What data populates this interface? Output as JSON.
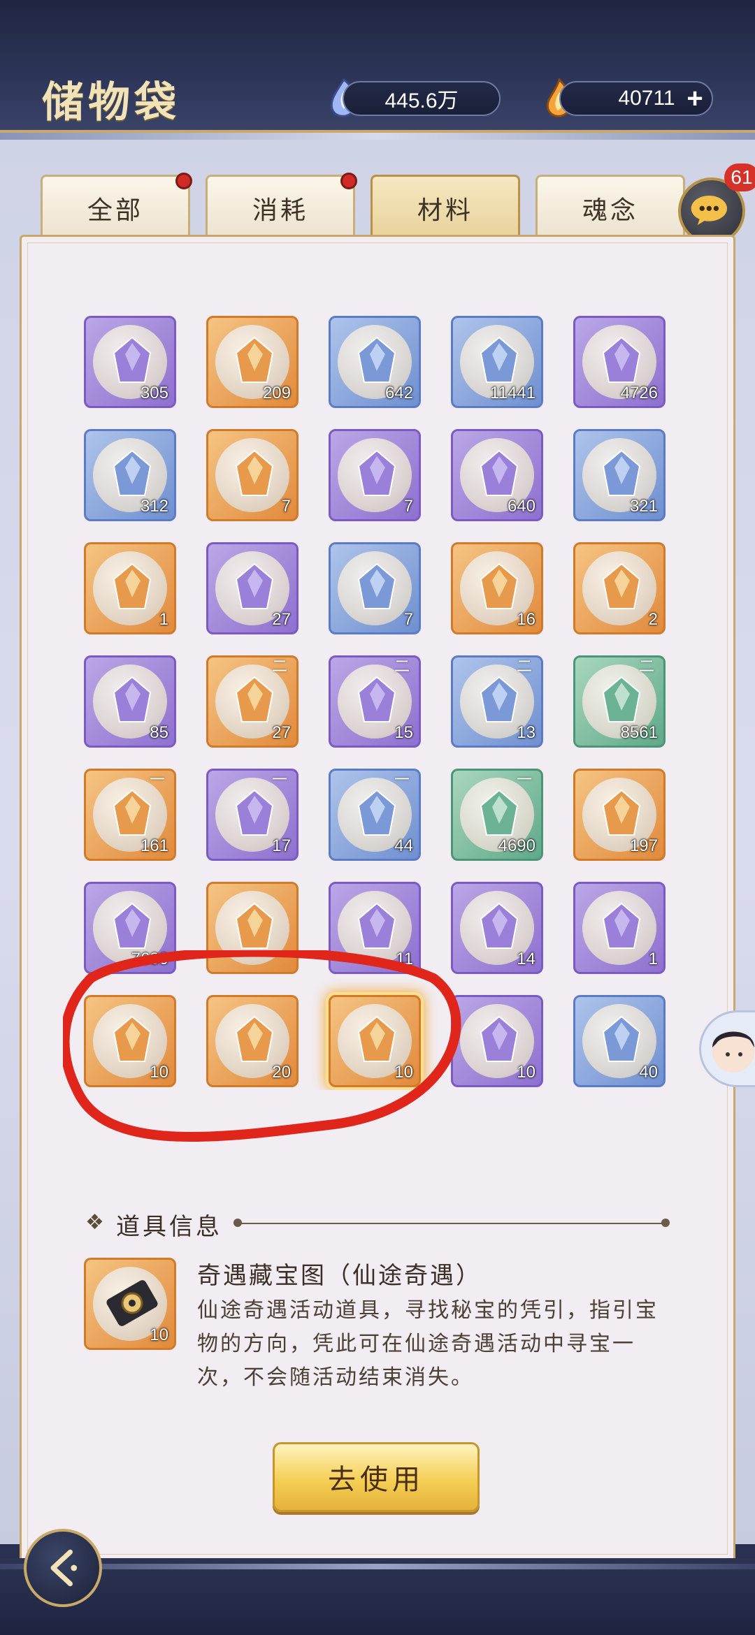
{
  "header": {
    "title": "储物袋",
    "currency_spirit": "445.6万",
    "currency_gold": "40711",
    "add_label": "+"
  },
  "tabs": [
    {
      "label": "全部",
      "has_dot": true
    },
    {
      "label": "消耗",
      "has_dot": true
    },
    {
      "label": "材料",
      "active": true
    },
    {
      "label": "魂念"
    }
  ],
  "chat": {
    "badge": "61",
    "icon": "chat-bubble-icon"
  },
  "grid": {
    "rows": [
      [
        {
          "count": "305",
          "rarity": "purple",
          "icon": "pink-gem-on-stand-icon"
        },
        {
          "count": "209",
          "rarity": "orange",
          "icon": "fire-beast-icon"
        },
        {
          "count": "642",
          "rarity": "blue",
          "icon": "blue-orb-icon"
        },
        {
          "count": "11441",
          "rarity": "blue",
          "icon": "cyan-crystal-shard-icon"
        },
        {
          "count": "4726",
          "rarity": "purple",
          "icon": "purple-crystal-cluster-icon"
        }
      ],
      [
        {
          "count": "312",
          "rarity": "blue",
          "icon": "blue-crystal-cluster-icon"
        },
        {
          "count": "7",
          "rarity": "orange",
          "icon": "red-pendant-icon"
        },
        {
          "count": "7",
          "rarity": "purple",
          "icon": "purple-crystal-icon"
        },
        {
          "count": "640",
          "rarity": "purple",
          "icon": "violet-crystal-icon"
        },
        {
          "count": "321",
          "rarity": "blue",
          "icon": "blue-egg-icon"
        }
      ],
      [
        {
          "count": "1",
          "rarity": "orange",
          "icon": "dark-sun-orb-icon"
        },
        {
          "count": "27",
          "rarity": "purple",
          "icon": "swirl-cloud-icon"
        },
        {
          "count": "7",
          "rarity": "blue",
          "icon": "gold-crystal-icon"
        },
        {
          "count": "16",
          "rarity": "orange",
          "icon": "scroll-bundle-icon"
        },
        {
          "count": "2",
          "rarity": "orange",
          "icon": "purple-scroll-icon"
        }
      ],
      [
        {
          "count": "85",
          "rarity": "purple",
          "icon": "green-herb-icon"
        },
        {
          "count": "27",
          "rarity": "orange",
          "icon": "blue-lotus-icon",
          "tier": "二"
        },
        {
          "count": "15",
          "rarity": "purple",
          "icon": "red-berries-icon",
          "tier": "二"
        },
        {
          "count": "13",
          "rarity": "blue",
          "icon": "stone-blocks-icon",
          "tier": "二"
        },
        {
          "count": "8561",
          "rarity": "green",
          "icon": "jade-ring-icon",
          "tier": "二"
        }
      ],
      [
        {
          "count": "161",
          "rarity": "orange",
          "icon": "purple-grass-icon",
          "tier": "一"
        },
        {
          "count": "17",
          "rarity": "purple",
          "icon": "orange-berries-icon",
          "tier": "一"
        },
        {
          "count": "44",
          "rarity": "blue",
          "icon": "red-tree-icon",
          "tier": "一"
        },
        {
          "count": "4690",
          "rarity": "green",
          "icon": "pink-coral-icon",
          "tier": "一"
        },
        {
          "count": "197",
          "rarity": "orange",
          "icon": "golden-crystal-cluster-icon"
        }
      ],
      [
        {
          "count": "7680",
          "rarity": "purple",
          "icon": "violet-shard-icon"
        },
        {
          "count": "",
          "rarity": "orange",
          "icon": "red-flame-orb-icon"
        },
        {
          "count": "11",
          "rarity": "purple",
          "icon": "purple-flame-orb-icon"
        },
        {
          "count": "14",
          "rarity": "purple",
          "icon": "orange-flame-orb-icon"
        },
        {
          "count": "1",
          "rarity": "purple",
          "icon": "blue-flame-orb-icon"
        }
      ],
      [
        {
          "count": "10",
          "rarity": "orange",
          "icon": "treasure-map-gold-icon"
        },
        {
          "count": "20",
          "rarity": "orange",
          "icon": "blue-ribbon-map-icon"
        },
        {
          "count": "10",
          "rarity": "orange",
          "icon": "treasure-map-dark-icon",
          "selected": true
        },
        {
          "count": "10",
          "rarity": "purple",
          "icon": "lilac-talisman-icon"
        },
        {
          "count": "40",
          "rarity": "blue",
          "icon": "lavender-talisman-icon"
        }
      ]
    ]
  },
  "info": {
    "section_title": "道具信息",
    "item_name": "奇遇藏宝图（仙途奇遇）",
    "item_count": "10",
    "description_lines": [
      "仙途奇遇活动道具，寻找秘宝的凭引，指引宝",
      "物的方向，凭此可在仙途奇遇活动中寻宝一",
      "次，不会随活动结束消失。"
    ]
  },
  "use_button": "去使用",
  "colors": {
    "purple": "#8e70cf",
    "orange": "#e18a3c",
    "blue": "#6f8fd0",
    "green": "#5fa989",
    "gold": "#c9a86a",
    "annotation_red": "#e0261b"
  }
}
